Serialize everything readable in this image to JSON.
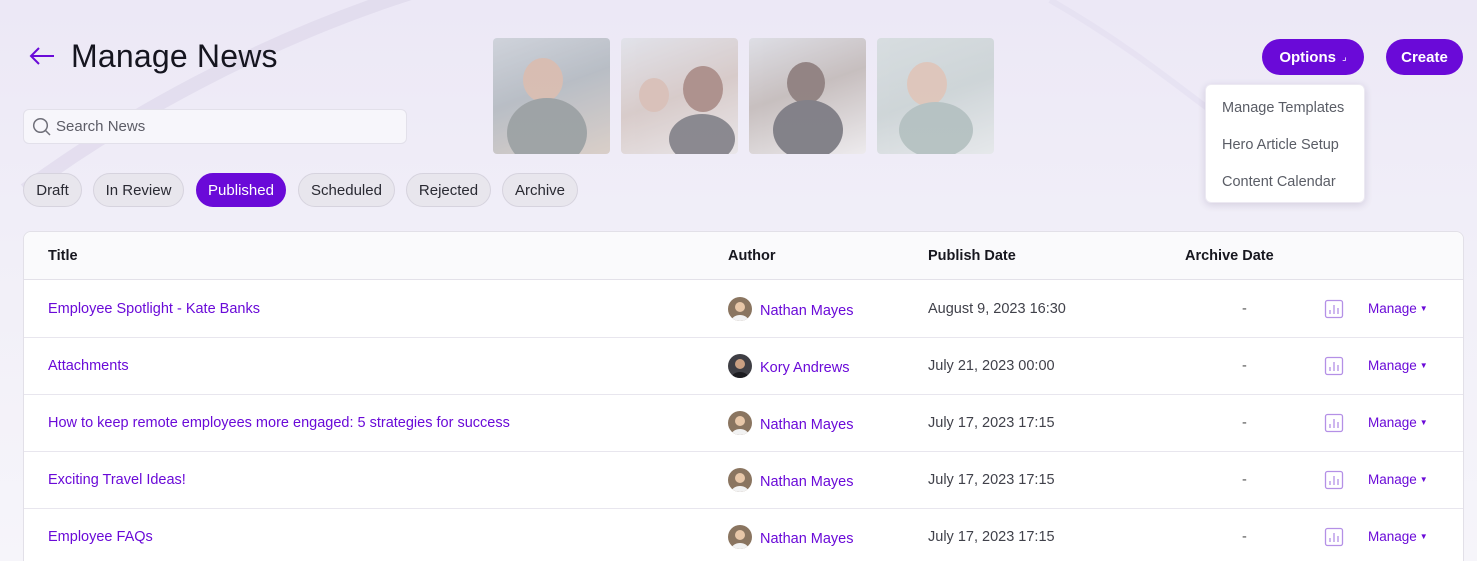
{
  "header": {
    "title": "Manage News",
    "back_icon": "arrow-left-icon"
  },
  "search": {
    "placeholder": "Search News",
    "value": ""
  },
  "buttons": {
    "options_label": "Options",
    "options_caret": "⌟",
    "create_label": "Create"
  },
  "options_menu": {
    "items": [
      "Manage Templates",
      "Hero Article Setup",
      "Content Calendar"
    ]
  },
  "tabs": {
    "items": [
      "Draft",
      "In Review",
      "Published",
      "Scheduled",
      "Rejected",
      "Archive"
    ],
    "active": "Published"
  },
  "table": {
    "columns": [
      "Title",
      "Author",
      "Publish Date",
      "Archive Date"
    ],
    "rows": [
      {
        "title": "Employee Spotlight - Kate Banks",
        "author": "Nathan Mayes",
        "publish_date": "August 9, 2023 16:30",
        "archive_date": "-",
        "manage": "Manage"
      },
      {
        "title": "Attachments",
        "author": "Kory Andrews",
        "publish_date": "July 21, 2023 00:00",
        "archive_date": "-",
        "manage": "Manage"
      },
      {
        "title": "How to keep remote employees more engaged: 5 strategies for success",
        "author": "Nathan Mayes",
        "publish_date": "July 17, 2023 17:15",
        "archive_date": "-",
        "manage": "Manage"
      },
      {
        "title": "Exciting Travel Ideas!",
        "author": "Nathan Mayes",
        "publish_date": "July 17, 2023 17:15",
        "archive_date": "-",
        "manage": "Manage"
      },
      {
        "title": "Employee FAQs",
        "author": "Nathan Mayes",
        "publish_date": "July 17, 2023 17:15",
        "archive_date": "-",
        "manage": "Manage"
      }
    ]
  },
  "colors": {
    "accent": "#6a0ad8",
    "background": "#ece8f6"
  }
}
